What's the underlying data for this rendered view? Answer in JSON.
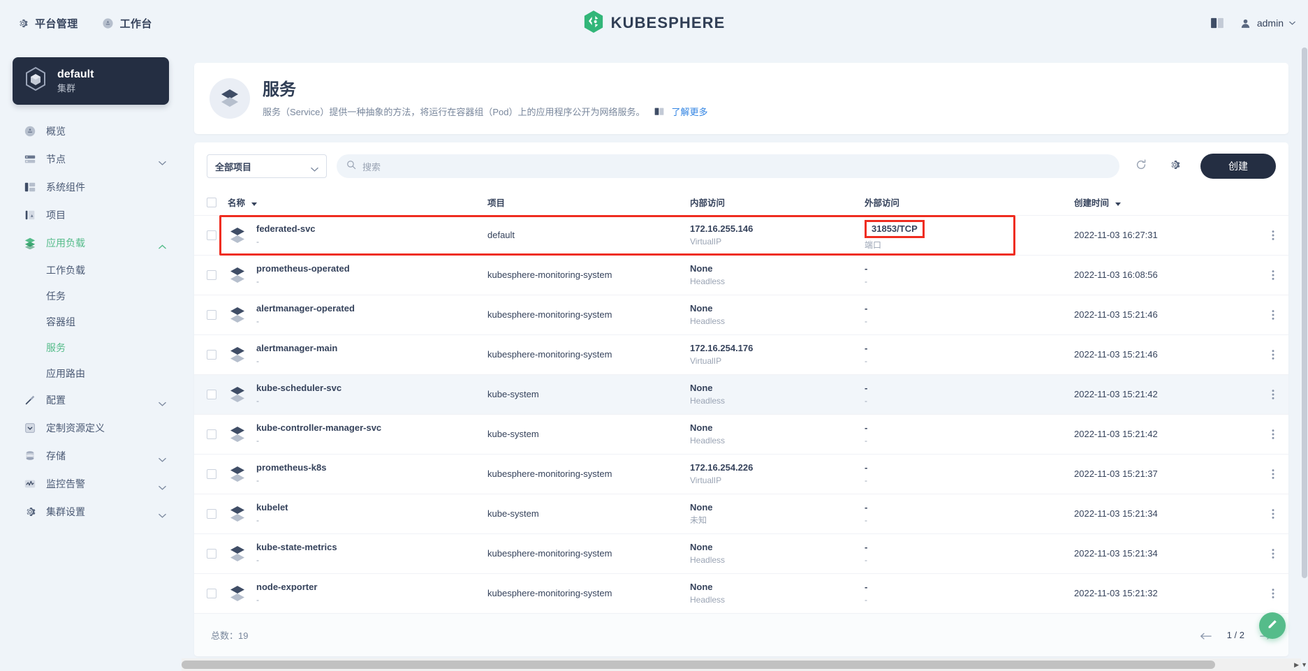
{
  "topbar": {
    "nav": [
      {
        "label": "平台管理",
        "icon": "gear-icon"
      },
      {
        "label": "工作台",
        "icon": "grid-icon"
      }
    ],
    "brand": "KUBESPHERE",
    "docs_icon": "book-icon",
    "user": "admin"
  },
  "sidebar": {
    "cluster": {
      "name": "default",
      "subtitle": "集群",
      "icon": "cube-icon"
    },
    "items": [
      {
        "label": "概览",
        "icon": "overview-icon",
        "expandable": false,
        "active": false
      },
      {
        "label": "节点",
        "icon": "nodes-icon",
        "expandable": true,
        "active": false
      },
      {
        "label": "系统组件",
        "icon": "components-icon",
        "expandable": false,
        "active": false
      },
      {
        "label": "项目",
        "icon": "projects-icon",
        "expandable": false,
        "active": false
      },
      {
        "label": "应用负载",
        "icon": "workloads-icon",
        "expandable": true,
        "active": true,
        "expanded": true
      }
    ],
    "sub_items": [
      {
        "label": "工作负载",
        "active": false
      },
      {
        "label": "任务",
        "active": false
      },
      {
        "label": "容器组",
        "active": false
      },
      {
        "label": "服务",
        "active": true
      },
      {
        "label": "应用路由",
        "active": false
      }
    ],
    "items_after": [
      {
        "label": "配置",
        "icon": "config-icon",
        "expandable": true,
        "active": false
      },
      {
        "label": "定制资源定义",
        "icon": "crd-icon",
        "expandable": false,
        "active": false
      },
      {
        "label": "存储",
        "icon": "storage-icon",
        "expandable": true,
        "active": false
      },
      {
        "label": "监控告警",
        "icon": "monitoring-icon",
        "expandable": true,
        "active": false
      },
      {
        "label": "集群设置",
        "icon": "settings-icon",
        "expandable": true,
        "active": false
      }
    ]
  },
  "banner": {
    "title": "服务",
    "description": "服务（Service）提供一种抽象的方法，将运行在容器组（Pod）上的应用程序公开为网络服务。",
    "link": "了解更多",
    "icon": "service-icon"
  },
  "toolbar": {
    "project_filter": "全部项目",
    "search_placeholder": "搜索",
    "refresh_icon": "refresh-icon",
    "settings_icon": "gear-icon",
    "create_label": "创建"
  },
  "table": {
    "columns": [
      {
        "key": "name",
        "label": "名称",
        "sortable": true
      },
      {
        "key": "project",
        "label": "项目",
        "sortable": false
      },
      {
        "key": "internal",
        "label": "内部访问",
        "sortable": false
      },
      {
        "key": "external",
        "label": "外部访问",
        "sortable": false
      },
      {
        "key": "created",
        "label": "创建时间",
        "sortable": true
      }
    ],
    "rows": [
      {
        "name": "federated-svc",
        "name_sub": "-",
        "project": "default",
        "internal": "172.16.255.146",
        "internal_sub": "VirtualIP",
        "external": "31853/TCP",
        "external_sub": "端口",
        "created": "2022-11-03 16:27:31",
        "highlight_row": true,
        "highlight_port": true
      },
      {
        "name": "prometheus-operated",
        "name_sub": "-",
        "project": "kubesphere-monitoring-system",
        "internal": "None",
        "internal_sub": "Headless",
        "external": "-",
        "external_sub": "-",
        "created": "2022-11-03 16:08:56"
      },
      {
        "name": "alertmanager-operated",
        "name_sub": "-",
        "project": "kubesphere-monitoring-system",
        "internal": "None",
        "internal_sub": "Headless",
        "external": "-",
        "external_sub": "-",
        "created": "2022-11-03 15:21:46"
      },
      {
        "name": "alertmanager-main",
        "name_sub": "-",
        "project": "kubesphere-monitoring-system",
        "internal": "172.16.254.176",
        "internal_sub": "VirtualIP",
        "external": "-",
        "external_sub": "-",
        "created": "2022-11-03 15:21:46"
      },
      {
        "name": "kube-scheduler-svc",
        "name_sub": "-",
        "project": "kube-system",
        "internal": "None",
        "internal_sub": "Headless",
        "external": "-",
        "external_sub": "-",
        "created": "2022-11-03 15:21:42",
        "alt": true
      },
      {
        "name": "kube-controller-manager-svc",
        "name_sub": "-",
        "project": "kube-system",
        "internal": "None",
        "internal_sub": "Headless",
        "external": "-",
        "external_sub": "-",
        "created": "2022-11-03 15:21:42"
      },
      {
        "name": "prometheus-k8s",
        "name_sub": "-",
        "project": "kubesphere-monitoring-system",
        "internal": "172.16.254.226",
        "internal_sub": "VirtualIP",
        "external": "-",
        "external_sub": "-",
        "created": "2022-11-03 15:21:37"
      },
      {
        "name": "kubelet",
        "name_sub": "-",
        "project": "kube-system",
        "internal": "None",
        "internal_sub": "未知",
        "external": "-",
        "external_sub": "-",
        "created": "2022-11-03 15:21:34"
      },
      {
        "name": "kube-state-metrics",
        "name_sub": "-",
        "project": "kubesphere-monitoring-system",
        "internal": "None",
        "internal_sub": "Headless",
        "external": "-",
        "external_sub": "-",
        "created": "2022-11-03 15:21:34"
      },
      {
        "name": "node-exporter",
        "name_sub": "-",
        "project": "kubesphere-monitoring-system",
        "internal": "None",
        "internal_sub": "Headless",
        "external": "-",
        "external_sub": "-",
        "created": "2022-11-03 15:21:32"
      }
    ]
  },
  "footer": {
    "total": "总数：19",
    "page": "1 / 2",
    "prev_icon": "arrow-left-icon",
    "next_icon": "arrow-right-icon"
  },
  "colors": {
    "accent": "#55bc8a",
    "dark": "#242e42",
    "link": "#3385e3",
    "highlight": "#ef2d20",
    "page_bg": "#eff4f9"
  }
}
